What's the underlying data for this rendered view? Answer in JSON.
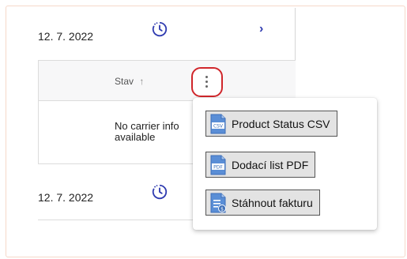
{
  "rows": [
    {
      "date": "12. 7. 2022"
    },
    {
      "date": "12. 7. 2022"
    }
  ],
  "table": {
    "column_header": "Stav",
    "sort_icon": "arrow-up-icon",
    "carrier_text_line1": "No carrier info",
    "carrier_text_line2": "available"
  },
  "menu": {
    "items": [
      {
        "label": "Product Status CSV",
        "icon": "csv-file-icon",
        "badge": "CSV"
      },
      {
        "label": "Dodací list PDF",
        "icon": "pdf-file-icon",
        "badge": "PDF"
      },
      {
        "label": "Stáhnout fakturu",
        "icon": "invoice-file-icon",
        "badge": ""
      }
    ]
  },
  "colors": {
    "accent": "#2f3bb0",
    "highlight": "#d0262b",
    "file_icon": "#5a8ed6"
  }
}
